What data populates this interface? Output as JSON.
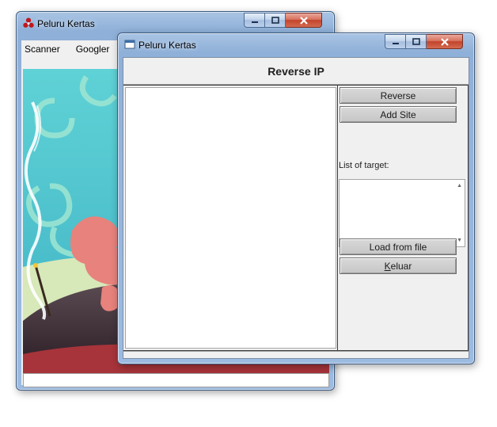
{
  "back_window": {
    "title": "Peluru Kertas",
    "menu": [
      "Scanner",
      "Googler"
    ]
  },
  "front_window": {
    "title": "Peluru Kertas",
    "header": "Reverse IP",
    "buttons": {
      "reverse": "Reverse",
      "add_site": "Add Site",
      "load_from_file": "Load from file",
      "keluar_mnemonic": "K",
      "keluar_rest": "eluar"
    },
    "list_label": "List of target:"
  },
  "colors": {
    "titlebar": "#9cbbe0",
    "close_button": "#c2432b",
    "client_bg": "#f0f0f0"
  },
  "icons": {
    "back_app": "red-tri-circle-icon",
    "front_app": "window-icon"
  }
}
